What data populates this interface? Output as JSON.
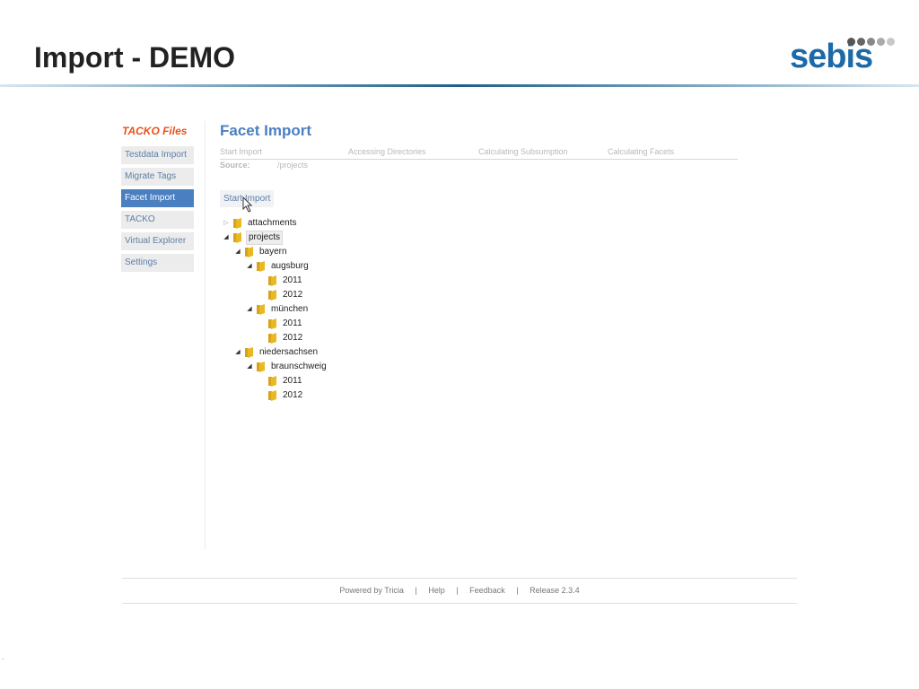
{
  "slide": {
    "title": "Import - DEMO",
    "logo_text": "sebis",
    "logo_dot_colors": [
      "#555555",
      "#666666",
      "#888888",
      "#aaaaaa",
      "#c8c8c8"
    ],
    "rule_color": "#1d5f8a"
  },
  "app": {
    "brand": "TACKO Files",
    "nav": [
      {
        "label": "Testdata Import",
        "active": false
      },
      {
        "label": "Migrate Tags",
        "active": false
      },
      {
        "label": "Facet Import",
        "active": true
      },
      {
        "label": "TACKO",
        "active": false
      },
      {
        "label": "Virtual Explorer",
        "active": false
      },
      {
        "label": "Settings",
        "active": false
      }
    ],
    "heading": "Facet Import",
    "steps": [
      "Start Import",
      "Accessing Directories",
      "Calculating Subsumption",
      "Calculating Facets"
    ],
    "source_label": "Source:",
    "source_value": "/projects",
    "start_button": "Start Import",
    "tree": [
      {
        "label": "attachments",
        "depth": 0,
        "toggle": "closed"
      },
      {
        "label": "projects",
        "depth": 0,
        "toggle": "open",
        "selected": true
      },
      {
        "label": "bayern",
        "depth": 1,
        "toggle": "open"
      },
      {
        "label": "augsburg",
        "depth": 2,
        "toggle": "open"
      },
      {
        "label": "2011",
        "depth": 3,
        "toggle": "none"
      },
      {
        "label": "2012",
        "depth": 3,
        "toggle": "none"
      },
      {
        "label": "münchen",
        "depth": 2,
        "toggle": "open"
      },
      {
        "label": "2011",
        "depth": 3,
        "toggle": "none"
      },
      {
        "label": "2012",
        "depth": 3,
        "toggle": "none"
      },
      {
        "label": "niedersachsen",
        "depth": 1,
        "toggle": "open"
      },
      {
        "label": "braunschweig",
        "depth": 2,
        "toggle": "open"
      },
      {
        "label": "2011",
        "depth": 3,
        "toggle": "none"
      },
      {
        "label": "2012",
        "depth": 3,
        "toggle": "none"
      }
    ],
    "footer": {
      "powered": "Powered by Tricia",
      "help": "Help",
      "feedback": "Feedback",
      "release": "Release 2.3.4",
      "separator": "|"
    },
    "accent_color": "#4a7fc1",
    "brand_color": "#e8521b",
    "folder_color": "#e8b923"
  },
  "corner_mark": "-"
}
